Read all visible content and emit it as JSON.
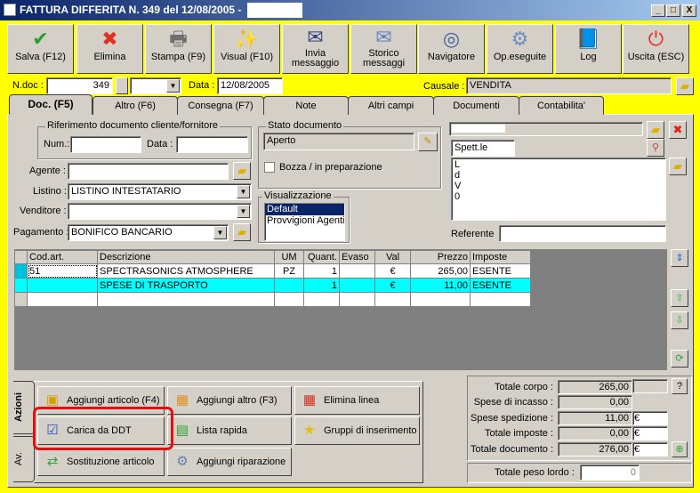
{
  "window": {
    "title": "FATTURA DIFFERITA N. 349  del 12/08/2005 -",
    "min": "_",
    "max": "□",
    "close": "X"
  },
  "toolbar": [
    {
      "label": "Salva (F12)",
      "icon": "checkmark-icon",
      "glyph": "✔",
      "color": "#2a9d2a"
    },
    {
      "label": "Elimina",
      "icon": "delete-x-icon",
      "glyph": "✖",
      "color": "#e03020"
    },
    {
      "label": "Stampa (F9)",
      "icon": "printer-icon",
      "glyph": "🖶",
      "color": "#707070"
    },
    {
      "label": "Visual (F10)",
      "icon": "magic-wand-icon",
      "glyph": "✨",
      "color": "#d0a000"
    },
    {
      "label": "Invia messaggio",
      "icon": "envelope-pen-icon",
      "glyph": "✉",
      "color": "#304080"
    },
    {
      "label": "Storico messaggi",
      "icon": "envelope-search-icon",
      "glyph": "✉",
      "color": "#6080c0"
    },
    {
      "label": "Navigatore",
      "icon": "compass-icon",
      "glyph": "◎",
      "color": "#4060a0"
    },
    {
      "label": "Op.eseguite",
      "icon": "gears-search-icon",
      "glyph": "⚙",
      "color": "#7090c0"
    },
    {
      "label": "Log",
      "icon": "book-search-icon",
      "glyph": "📘",
      "color": "#2050c0"
    },
    {
      "label": "Uscita (ESC)",
      "icon": "power-icon",
      "glyph": "⏻",
      "color": "#e03020"
    }
  ],
  "header": {
    "ndoc_label": "N.doc :",
    "ndoc": "349",
    "data_label": "Data :",
    "data": "12/08/2005",
    "causale_label": "Causale :",
    "causale": "VENDITA"
  },
  "tabs": [
    "Doc. (F5)",
    "Altro (F6)",
    "Consegna (F7)",
    "Note",
    "Altri campi",
    "Documenti",
    "Contabilita'"
  ],
  "rif": {
    "title": "Riferimento documento cliente/fornitore",
    "num_label": "Num.:",
    "num": "",
    "data_label": "Data :",
    "data": ""
  },
  "fields": {
    "agente_label": "Agente :",
    "agente": "",
    "listino_label": "Listino :",
    "listino": "LISTINO INTESTATARIO",
    "venditore_label": "Venditore :",
    "venditore": "",
    "pagamento_label": "Pagamento :",
    "pagamento": "BONIFICO BANCARIO"
  },
  "stato": {
    "title": "Stato documento",
    "value": "Aperto",
    "bozza_label": "Bozza / in preparazione",
    "bozza_checked": false
  },
  "visual": {
    "title": "Visualizzazione",
    "options": [
      "Default",
      "Provvigioni Agenti"
    ],
    "selected": "Default"
  },
  "cliente": {
    "title_prefix": "Spett.le",
    "address_lines": [
      "L",
      "d",
      "V",
      "0"
    ],
    "referente_label": "Referente",
    "referente": ""
  },
  "grid": {
    "columns": [
      "Cod.art.",
      "Descrizione",
      "UM",
      "Quant.",
      "Evaso",
      "Val",
      "Prezzo",
      "Imposte"
    ],
    "rows": [
      [
        "51",
        "SPECTRASONICS ATMOSPHERE",
        "PZ",
        "1",
        "",
        "€",
        "265,00",
        "ESENTE"
      ],
      [
        "",
        "SPESE DI TRASPORTO",
        "",
        "1",
        "",
        "€",
        "11,00",
        "ESENTE"
      ],
      [
        "",
        "",
        "",
        "",
        "",
        "",
        "",
        ""
      ]
    ]
  },
  "actions": {
    "tab_azioni": "Azioni",
    "tab_av": "Av.",
    "buttons": [
      "Aggiungi articolo (F4)",
      "Aggiungi altro (F3)",
      "Elimina linea",
      "Carica da DDT",
      "Lista rapida",
      "Gruppi di inserimento",
      "Sostituzione articolo",
      "Aggiungi riparazione"
    ],
    "highlight_color": "#e01010"
  },
  "totals": {
    "corpo_label": "Totale corpo :",
    "corpo": "265,00",
    "incasso_label": "Spese di incasso :",
    "incasso": "0,00",
    "spedizione_label": "Spese spedizione :",
    "spedizione": "11,00",
    "imposte_label": "Totale imposte :",
    "imposte": "0,00",
    "documento_label": "Totale documento :",
    "documento": "276,00",
    "currency": "€",
    "help": "?",
    "peso_label": "Totale peso lordo :",
    "peso": "0"
  }
}
